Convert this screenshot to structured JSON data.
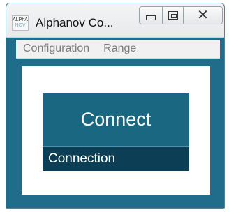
{
  "window": {
    "title": "Alphanov Co...",
    "icon_text_line1": "ALPhA",
    "icon_text_line2": "NOV"
  },
  "menu": {
    "items": [
      {
        "label": "Configuration"
      },
      {
        "label": "Range"
      }
    ]
  },
  "main": {
    "connect_label": "Connect",
    "status_label": "Connection"
  },
  "icons": {
    "minimize": "minimize-icon",
    "maximize": "maximize-icon",
    "close": "close-icon",
    "app": "app-logo-icon"
  },
  "colors": {
    "frame": "#1f6d8a",
    "connect_bg": "#1a6781",
    "status_bg": "#0c3e55",
    "menu_text": "#7b7b7b"
  }
}
